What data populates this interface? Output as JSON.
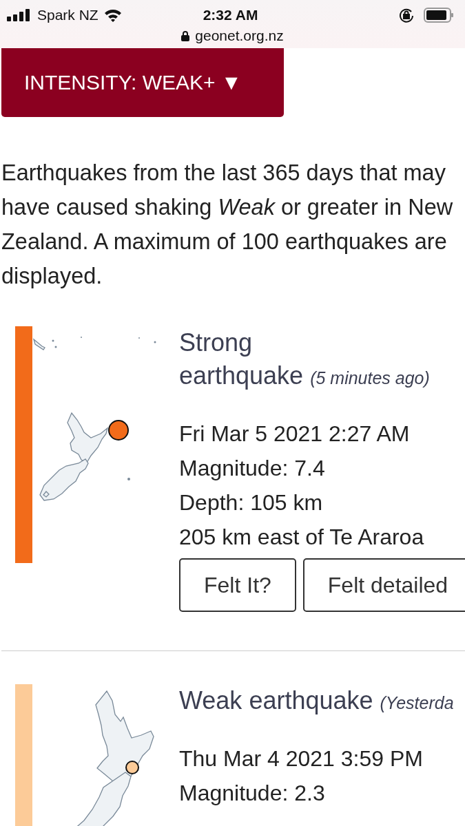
{
  "status_bar": {
    "carrier": "Spark NZ",
    "time": "2:32 AM",
    "url": "geonet.org.nz"
  },
  "filter_button": {
    "label": "INTENSITY: WEAK+ ▼"
  },
  "intro": "Earthquakes from the last 365 days that may have caused shaking *Weak* or greater in New Zealand. A maximum of 100 earthquakes are displayed.",
  "quakes": [
    {
      "title": "Strong earthquake",
      "ago": "(5 minutes ago)",
      "color": "#f26b1a",
      "kind": "national",
      "details": [
        "Fri Mar 5 2021 2:27 AM",
        "Magnitude: 7.4",
        "Depth: 105 km",
        "205 km east of Te Araroa"
      ],
      "buttons": [
        "Felt It?",
        "Felt detailed"
      ]
    },
    {
      "title": "Weak earthquake",
      "ago": "(Yesterda",
      "color": "#fccb98",
      "kind": "central",
      "details": [
        "Thu Mar 4 2021 3:59 PM",
        "Magnitude: 2.3"
      ]
    }
  ]
}
